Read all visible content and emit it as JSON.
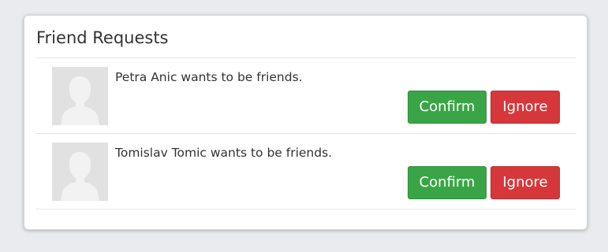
{
  "panel": {
    "title": "Friend Requests"
  },
  "requests": [
    {
      "text": "Petra Anic wants to be friends.",
      "confirm_label": "Confirm",
      "ignore_label": "Ignore"
    },
    {
      "text": "Tomislav Tomic wants to be friends.",
      "confirm_label": "Confirm",
      "ignore_label": "Ignore"
    }
  ],
  "colors": {
    "confirm": "#3aa546",
    "ignore": "#d6373b",
    "avatar_placeholder": "#e1e1e1",
    "page_background": "#e9ebee"
  }
}
